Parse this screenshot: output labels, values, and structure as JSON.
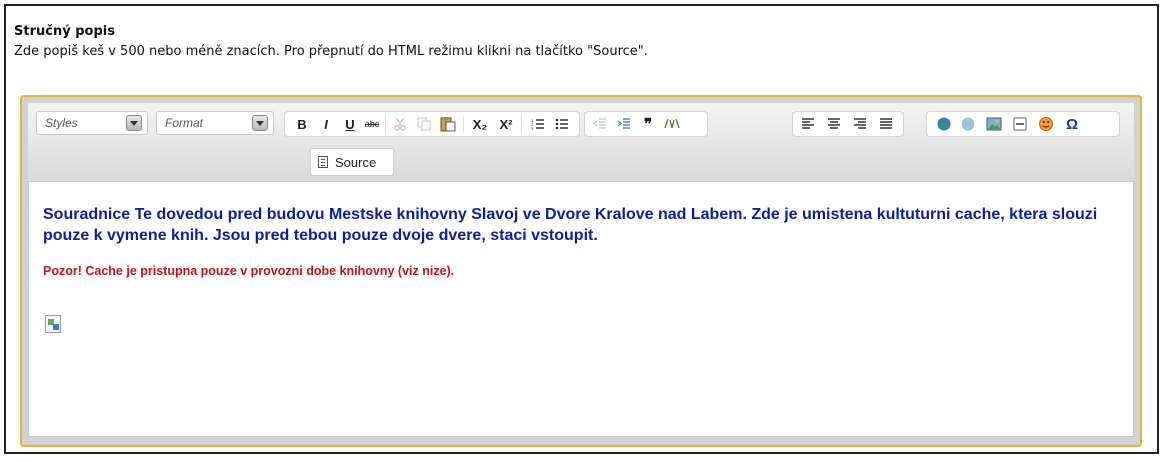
{
  "section": {
    "heading": "Stručný popis",
    "description": "Zde popiš keš v 500 nebo méně znacích. Pro přepnutí do HTML režimu klikni na tlačítko \"Source\"."
  },
  "toolbar": {
    "styles_label": "Styles",
    "format_label": "Format",
    "bold": "B",
    "italic": "I",
    "underline": "U",
    "strike": "abc",
    "subscript": "X₂",
    "superscript": "X²",
    "quote": "❞",
    "omega": "Ω",
    "source_label": "Source"
  },
  "content": {
    "paragraph1": "Souradnice Te dovedou pred budovu Mestske knihovny Slavoj ve Dvore Kralove nad Labem. Zde je umistena kultuturni cache, ktera slouzi pouze k vymene knih. Jsou pred tebou pouze dvoje dvere, staci vstoupit.",
    "paragraph2": "Pozor! Cache je pristupna pouze v provozni dobe knihovny (viz nize)."
  },
  "colors": {
    "accent_border": "#e3b43a",
    "text_blue": "#0b1f9e",
    "text_red": "#c0141a"
  }
}
